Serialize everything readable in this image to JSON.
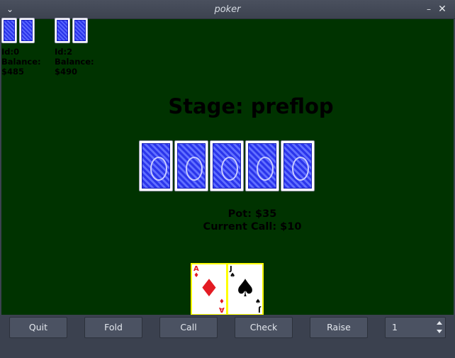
{
  "window": {
    "title": "poker",
    "menu_icon": "chevron-down-icon",
    "close_icon": "close-icon",
    "minimize_icon": "minimize-icon"
  },
  "opponents": [
    {
      "id_label": "Id:0",
      "balance_label": "Balance:",
      "balance": "$485"
    },
    {
      "id_label": "Id:2",
      "balance_label": "Balance:",
      "balance": "$490"
    }
  ],
  "stage": "Stage: preflop",
  "board": {
    "count": 5,
    "face": "down"
  },
  "pot": "Pot: $35",
  "current_call": "Current Call: $10",
  "hand": [
    {
      "rank": "A",
      "suit": "♦",
      "color": "#e31b23"
    },
    {
      "rank": "J",
      "suit": "♠",
      "color": "#000000"
    }
  ],
  "controls": {
    "quit": "Quit",
    "fold": "Fold",
    "call": "Call",
    "check": "Check",
    "raise": "Raise",
    "raise_amount": "1"
  },
  "colors": {
    "table": "#003300",
    "highlight": "#ffff00",
    "card_back": "#2a34e8"
  }
}
